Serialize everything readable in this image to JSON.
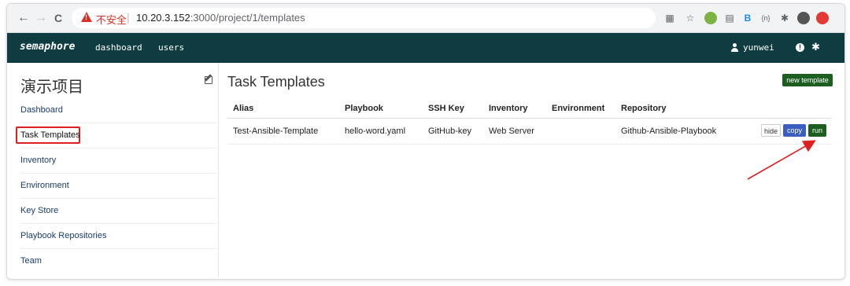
{
  "browser": {
    "insecure_label": "不安全",
    "url_host": "10.20.3.152",
    "url_rest": ":3000/project/1/templates",
    "nav_back": "←",
    "nav_forward": "→",
    "nav_reload": "C"
  },
  "navbar": {
    "brand": "semaphore",
    "links": [
      "dashboard",
      "users"
    ],
    "username": "yunwei"
  },
  "sidebar": {
    "project_title": "演示项目",
    "items": [
      "Dashboard",
      "Task Templates",
      "Inventory",
      "Environment",
      "Key Store",
      "Playbook Repositories",
      "Team"
    ],
    "selected_index": 1
  },
  "main": {
    "title": "Task Templates",
    "new_button": "new template",
    "columns": [
      "Alias",
      "Playbook",
      "SSH Key",
      "Inventory",
      "Environment",
      "Repository"
    ],
    "rows": [
      {
        "alias": "Test-Ansible-Template",
        "playbook": "hello-word.yaml",
        "ssh_key": "GitHub-key",
        "inventory": "Web Server",
        "environment": "",
        "repository": "Github-Ansible-Playbook",
        "actions": [
          "hide",
          "copy",
          "run"
        ]
      }
    ]
  },
  "colors": {
    "navbar_bg": "#0f3c40",
    "primary_green": "#1b5e20",
    "copy_blue": "#3b5fc0",
    "annotation_red": "#e02020"
  },
  "icons": [
    "warning-icon",
    "user-icon",
    "info-icon",
    "gear-icon",
    "edit-icon",
    "translate-icon",
    "star-icon",
    "extension-icon",
    "profile-icon",
    "opera-icon"
  ]
}
